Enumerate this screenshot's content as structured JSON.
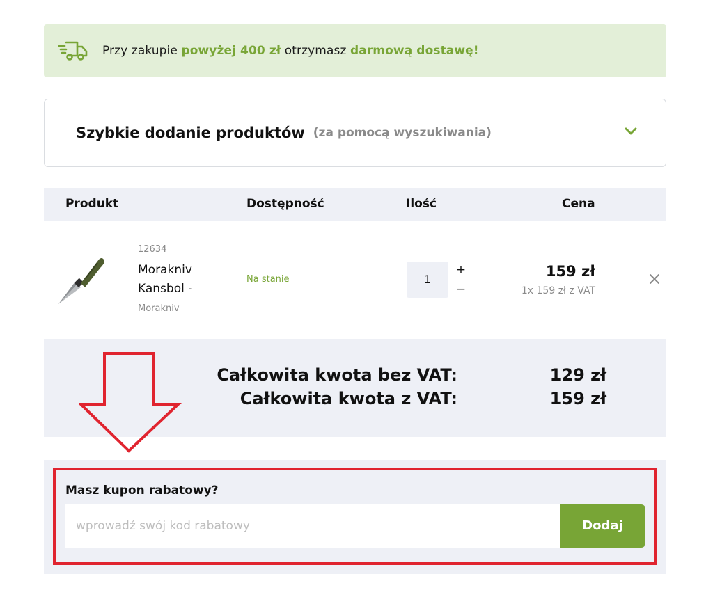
{
  "banner": {
    "text_before": "Przy zakupie ",
    "highlight1": "powyżej 400 zł",
    "text_middle": " otrzymasz ",
    "highlight2": "darmową dostawę!"
  },
  "quick_add": {
    "title": "Szybkie dodanie produktów",
    "subtitle": "(za pomocą wyszukiwania)"
  },
  "table": {
    "headers": {
      "product": "Produkt",
      "availability": "Dostępność",
      "quantity": "Ilość",
      "price": "Cena"
    },
    "rows": [
      {
        "sku": "12634",
        "name": "Morakniv Kansbol -",
        "brand": "Morakniv",
        "availability": "Na stanie",
        "quantity": "1",
        "plus": "+",
        "minus": "−",
        "price": "159 zł",
        "price_detail": "1x 159 zł z VAT"
      }
    ]
  },
  "totals": {
    "net_label": "Całkowita kwota bez VAT:",
    "net_value": "129 zł",
    "gross_label": "Całkowita kwota z VAT:",
    "gross_value": "159 zł"
  },
  "coupon": {
    "title": "Masz kupon rabatowy?",
    "placeholder": "wprowadź swój kod rabatowy",
    "button": "Dodaj"
  },
  "colors": {
    "accent_green": "#78a536",
    "banner_bg": "#e3efd8",
    "panel_bg": "#eef0f6",
    "annotation_red": "#e0242f"
  },
  "icons": [
    "truck-icon",
    "chevron-down-icon",
    "close-icon",
    "down-arrow-annotation"
  ]
}
